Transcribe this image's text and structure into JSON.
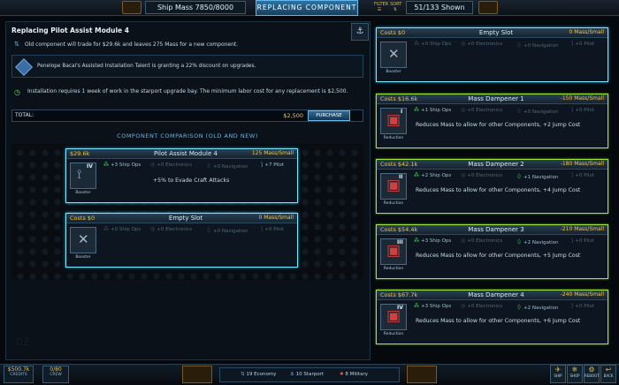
{
  "topbar": {
    "ship_mass": "Ship Mass 7850/8000",
    "mode": "REPLACING COMPONENT",
    "filter_label": "FILTER",
    "sort_label": "SORT",
    "shown": "51/133 Shown"
  },
  "left": {
    "title": "Replacing Pilot Assist Module 4",
    "info1": "Old component will trade for $29.6k and leaves 275 Mass for a new component.",
    "info2": "Penelope Bacal's Assisted Installation Talent is granting a 22% discount on upgrades.",
    "info3": "Installation requires 1 week of work in the starport upgrade bay. The minimum labor cost for any replacement is $2,500.",
    "total_label": "TOTAL:",
    "total_value": "$2,500",
    "purchase_label": "PURCHASE",
    "comparison_header": "COMPONENT COMPARISON (OLD AND NEW)",
    "watermark": "02"
  },
  "compare_cards": [
    {
      "cost": "$29.6k",
      "name": "Pilot Assist Module 4",
      "mass": "125 Mass/Small",
      "level": "IV",
      "type": "Booster",
      "stats": [
        "+3 Ship Ops",
        "+0 Electronics",
        "+0 Navigation",
        "+7 Pilot"
      ],
      "desc": "+5% to Evade Craft Attacks"
    },
    {
      "cost": "Costs $0",
      "name": "Empty Slot",
      "mass": "0 Mass/Small",
      "level": "",
      "type": "Booster",
      "stats": [
        "+0 Ship Ops",
        "+0 Electronics",
        "+0 Navigation",
        "+0 Pilot"
      ],
      "desc": ""
    }
  ],
  "list_cards": [
    {
      "cost": "Costs $0",
      "name": "Empty Slot",
      "mass": "0 Mass/Small",
      "level": "",
      "type": "Booster",
      "stats": [
        "+0 Ship Ops",
        "+0 Electronics",
        "+0 Navigation",
        "+0 Pilot"
      ],
      "desc": ""
    },
    {
      "cost": "Costs $16.6k",
      "name": "Mass Dampener 1",
      "mass": "-150 Mass/Small",
      "level": "I",
      "type": "Reduction",
      "stats": [
        "+1 Ship Ops",
        "+0 Electronics",
        "+0 Navigation",
        "+0 Pilot"
      ],
      "desc": "Reduces Mass to allow for other Components, +2 Jump Cost"
    },
    {
      "cost": "Costs $42.1k",
      "name": "Mass Dampener 2",
      "mass": "-180 Mass/Small",
      "level": "II",
      "type": "Reduction",
      "stats": [
        "+2 Ship Ops",
        "+0 Electronics",
        "+1 Navigation",
        "+0 Pilot"
      ],
      "desc": "Reduces Mass to allow for other Components, +4 Jump Cost"
    },
    {
      "cost": "Costs $54.4k",
      "name": "Mass Dampener 3",
      "mass": "-210 Mass/Small",
      "level": "III",
      "type": "Reduction",
      "stats": [
        "+3 Ship Ops",
        "+0 Electronics",
        "+2 Navigation",
        "+0 Pilot"
      ],
      "desc": "Reduces Mass to allow for other Components, +5 Jump Cost"
    },
    {
      "cost": "Costs $67.7k",
      "name": "Mass Dampener 4",
      "mass": "-240 Mass/Small",
      "level": "IV",
      "type": "Reduction",
      "stats": [
        "+3 Ship Ops",
        "+0 Electronics",
        "+2 Navigation",
        "+0 Pilot"
      ],
      "desc": "Reduces Mass to allow for other Components, +6 Jump Cost"
    }
  ],
  "bottombar": {
    "credits_value": "$500.7k",
    "credits_label": "CREDITS",
    "crew_value": "0/80",
    "crew_label": "CREW",
    "economy": "19 Economy",
    "starport": "10 Starport",
    "military": "8 Military",
    "btn1": "SHIP",
    "btn2": "SHOP",
    "btn3": "REBOOT",
    "btn4": "BACK"
  },
  "colors": {
    "accent": "#7fe8ff",
    "cost": "#f2c44c",
    "stat_active": "#4de35a",
    "selected_border": "#9ee83a"
  }
}
